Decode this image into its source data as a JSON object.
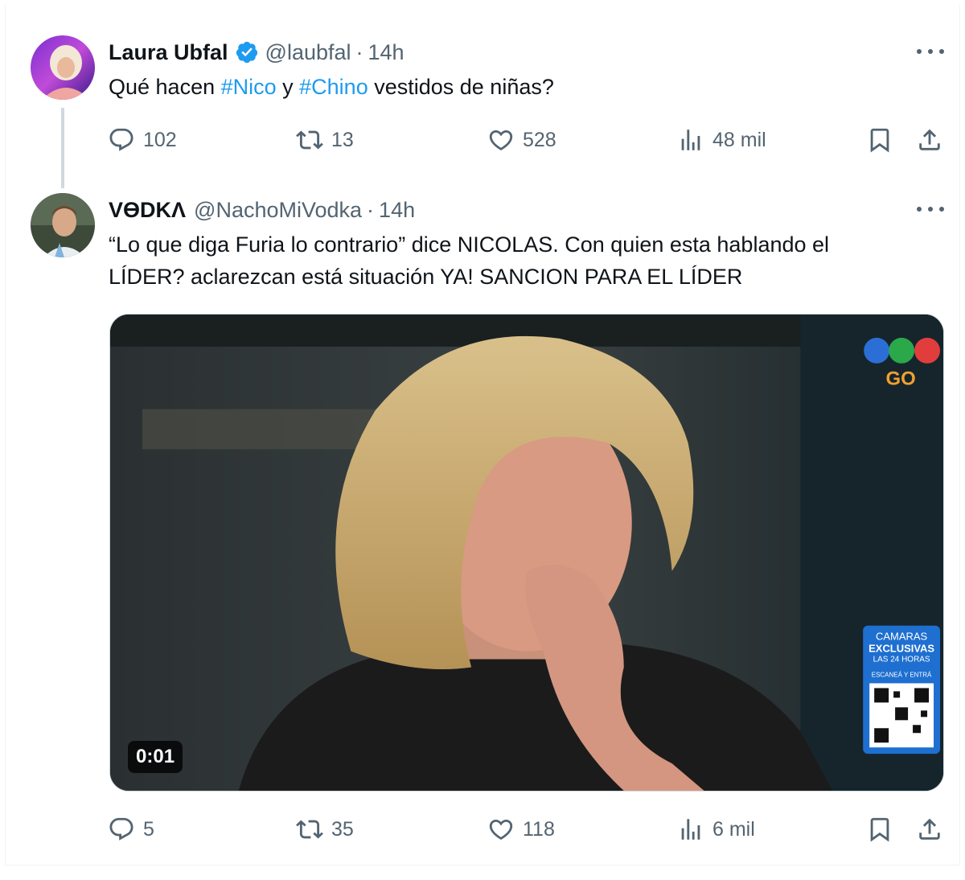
{
  "tweets": [
    {
      "author_name": "Laura Ubfal",
      "verified": true,
      "handle": "@laubfal",
      "separator": "·",
      "time": "14h",
      "text_parts": [
        "Qué hacen ",
        "#Nico",
        " y ",
        "#Chino",
        " vestidos de niñas?"
      ],
      "actions": {
        "replies": "102",
        "reposts": "13",
        "likes": "528",
        "views": "48 mil"
      }
    },
    {
      "author_name": "VƟDKΛ",
      "verified": false,
      "handle": "@NachoMiVodka",
      "separator": "·",
      "time": "14h",
      "text_line1": "“Lo que diga Furia lo contrario” dice NICOLAS. Con quien esta hablando el",
      "text_line2": "LÍDER? aclarezcan está situación YA! SANCION PARA EL LÍDER",
      "media": {
        "type": "video",
        "duration": "0:01",
        "overlay_logo_text": "GO",
        "overlay_banner": {
          "line1": "CAMARAS",
          "line2": "EXCLUSIVAS",
          "line3": "LAS 24 HORAS",
          "line4": "ESCANEÁ Y ENTRÁ"
        }
      },
      "actions": {
        "replies": "5",
        "reposts": "35",
        "likes": "118",
        "views": "6 mil"
      }
    }
  ],
  "icons": {
    "reply": "reply-icon",
    "repost": "repost-icon",
    "like": "heart-icon",
    "views": "views-chart-icon",
    "bookmark": "bookmark-icon",
    "share": "share-icon",
    "more": "more-dots-icon",
    "verified": "verified-badge-icon"
  },
  "colors": {
    "accent": "#1d9bf0",
    "secondary_text": "#536471",
    "primary_text": "#0f1419"
  }
}
